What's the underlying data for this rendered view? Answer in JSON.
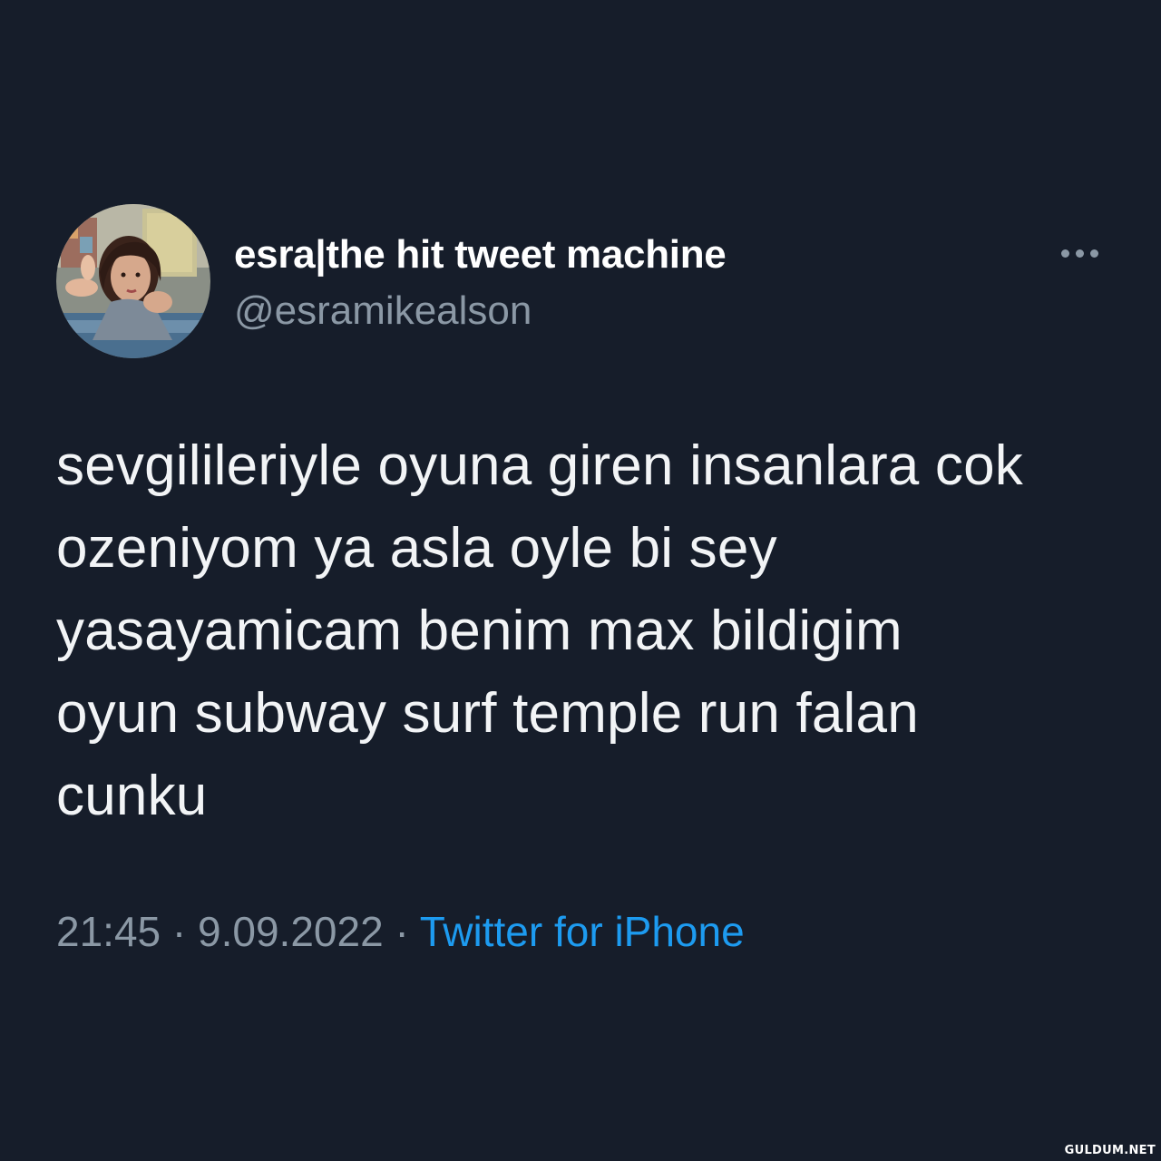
{
  "tweet": {
    "author_name": "esra|the hit tweet machine",
    "author_handle": "@esramikealson",
    "more_icon": "ellipsis-icon",
    "lines": [
      "sevgilileriyle oyuna giren insanlara cok",
      "ozeniyom ya asla oyle bi sey",
      "yasayamicam benim max bildigim",
      "oyun subway surf temple run falan",
      "cunku"
    ],
    "time": "21:45",
    "separator": "·",
    "date": "9.09.2022",
    "source": "Twitter for iPhone"
  },
  "watermark": "GULDUM.NET",
  "colors": {
    "background": "#161d2a",
    "text": "#f2f4f6",
    "muted": "#8b98a5",
    "link": "#1d9bf0"
  }
}
